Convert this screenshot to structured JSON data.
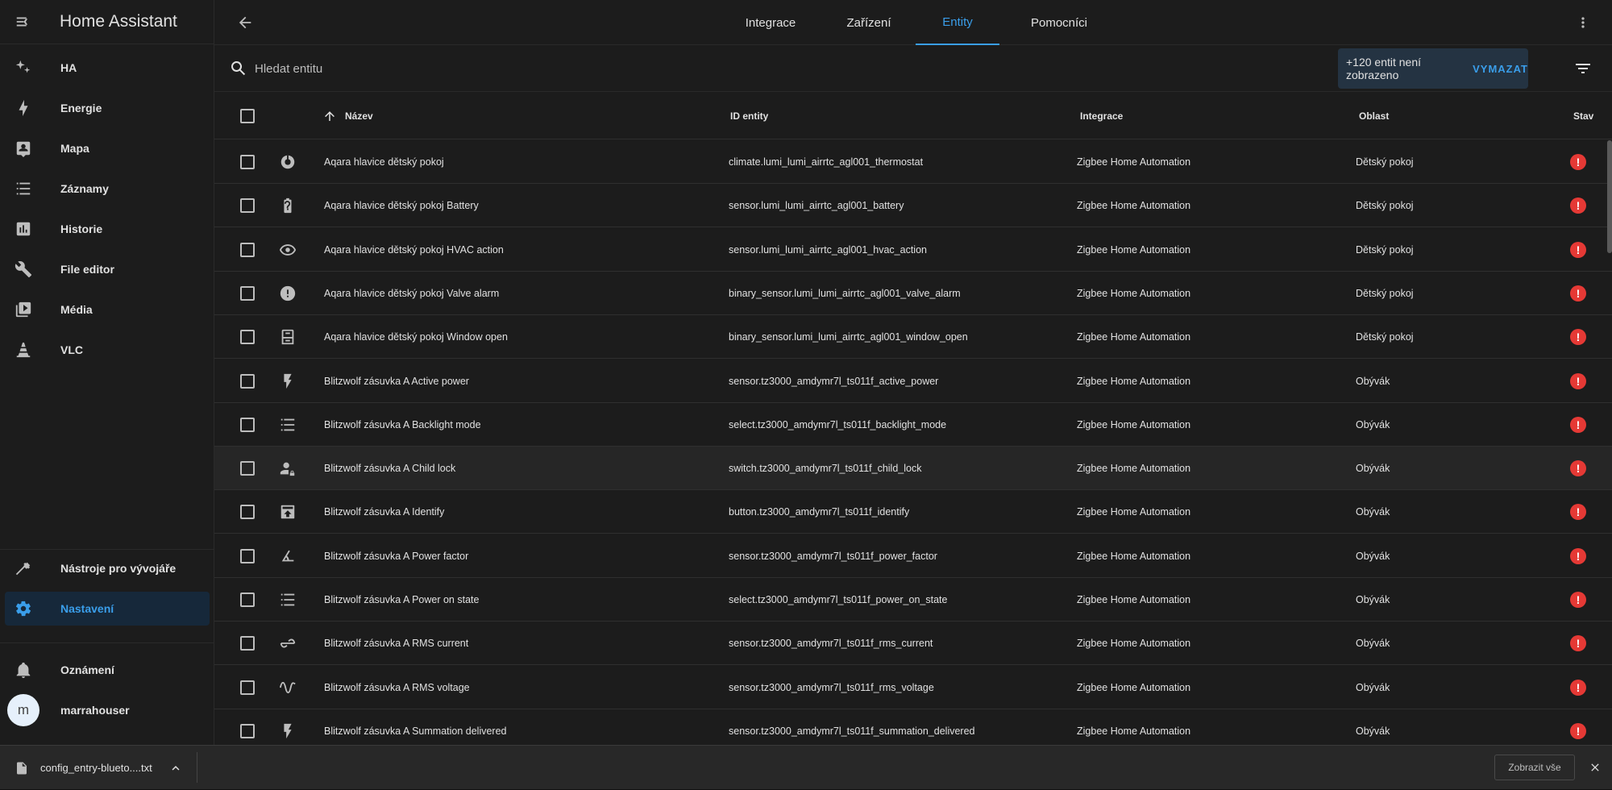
{
  "app": {
    "title": "Home Assistant"
  },
  "sidebar": {
    "items": [
      {
        "label": "HA",
        "icon": "sparkles-icon"
      },
      {
        "label": "Energie",
        "icon": "lightning-icon"
      },
      {
        "label": "Mapa",
        "icon": "map-account-icon"
      },
      {
        "label": "Záznamy",
        "icon": "list-icon"
      },
      {
        "label": "Historie",
        "icon": "chart-box-icon"
      },
      {
        "label": "File editor",
        "icon": "wrench-icon"
      },
      {
        "label": "Média",
        "icon": "play-box-icon"
      },
      {
        "label": "VLC",
        "icon": "vlc-cone-icon"
      }
    ],
    "bottom_items": [
      {
        "label": "Nástroje pro vývojáře",
        "icon": "hammer-icon"
      },
      {
        "label": "Nastavení",
        "icon": "gear-icon"
      }
    ],
    "notifications": "Oznámení",
    "user": {
      "initial": "m",
      "name": "marrahouser"
    }
  },
  "tabs": [
    {
      "label": "Integrace"
    },
    {
      "label": "Zařízení"
    },
    {
      "label": "Entity"
    },
    {
      "label": "Pomocníci"
    }
  ],
  "search": {
    "placeholder": "Hledat entitu",
    "hidden_text": "+120 entit není zobrazeno",
    "clear_label": "VYMAZAT"
  },
  "table": {
    "headers": {
      "name": "Název",
      "entity_id": "ID entity",
      "integration": "Integrace",
      "area": "Oblast",
      "status": "Stav"
    },
    "rows": [
      {
        "icon": "thermostat-icon",
        "name": "Aqara hlavice dětský pokoj",
        "entity_id": "climate.lumi_lumi_airrtc_agl001_thermostat",
        "integration": "Zigbee Home Automation",
        "area": "Dětský pokoj"
      },
      {
        "icon": "battery-unknown-icon",
        "name": "Aqara hlavice dětský pokoj Battery",
        "entity_id": "sensor.lumi_lumi_airrtc_agl001_battery",
        "integration": "Zigbee Home Automation",
        "area": "Dětský pokoj"
      },
      {
        "icon": "eye-icon",
        "name": "Aqara hlavice dětský pokoj HVAC action",
        "entity_id": "sensor.lumi_lumi_airrtc_agl001_hvac_action",
        "integration": "Zigbee Home Automation",
        "area": "Dětský pokoj"
      },
      {
        "icon": "alert-circle-icon",
        "name": "Aqara hlavice dětský pokoj Valve alarm",
        "entity_id": "binary_sensor.lumi_lumi_airrtc_agl001_valve_alarm",
        "integration": "Zigbee Home Automation",
        "area": "Dětský pokoj"
      },
      {
        "icon": "window-icon",
        "name": "Aqara hlavice dětský pokoj Window open",
        "entity_id": "binary_sensor.lumi_lumi_airrtc_agl001_window_open",
        "integration": "Zigbee Home Automation",
        "area": "Dětský pokoj"
      },
      {
        "icon": "flash-icon",
        "name": "Blitzwolf zásuvka A Active power",
        "entity_id": "sensor.tz3000_amdymr7l_ts011f_active_power",
        "integration": "Zigbee Home Automation",
        "area": "Obývák"
      },
      {
        "icon": "format-list-icon",
        "name": "Blitzwolf zásuvka A Backlight mode",
        "entity_id": "select.tz3000_amdymr7l_ts011f_backlight_mode",
        "integration": "Zigbee Home Automation",
        "area": "Obývák"
      },
      {
        "icon": "account-lock-icon",
        "name": "Blitzwolf zásuvka A Child lock",
        "entity_id": "switch.tz3000_amdymr7l_ts011f_child_lock",
        "integration": "Zigbee Home Automation",
        "area": "Obývák"
      },
      {
        "icon": "identify-icon",
        "name": "Blitzwolf zásuvka A Identify",
        "entity_id": "button.tz3000_amdymr7l_ts011f_identify",
        "integration": "Zigbee Home Automation",
        "area": "Obývák"
      },
      {
        "icon": "angle-acute-icon",
        "name": "Blitzwolf zásuvka A Power factor",
        "entity_id": "sensor.tz3000_amdymr7l_ts011f_power_factor",
        "integration": "Zigbee Home Automation",
        "area": "Obývák"
      },
      {
        "icon": "format-list-icon",
        "name": "Blitzwolf zásuvka A Power on state",
        "entity_id": "select.tz3000_amdymr7l_ts011f_power_on_state",
        "integration": "Zigbee Home Automation",
        "area": "Obývák"
      },
      {
        "icon": "current-ac-icon",
        "name": "Blitzwolf zásuvka A RMS current",
        "entity_id": "sensor.tz3000_amdymr7l_ts011f_rms_current",
        "integration": "Zigbee Home Automation",
        "area": "Obývák"
      },
      {
        "icon": "sine-wave-icon",
        "name": "Blitzwolf zásuvka A RMS voltage",
        "entity_id": "sensor.tz3000_amdymr7l_ts011f_rms_voltage",
        "integration": "Zigbee Home Automation",
        "area": "Obývák"
      },
      {
        "icon": "flash-icon",
        "name": "Blitzwolf zásuvka A Summation delivered",
        "entity_id": "sensor.tz3000_amdymr7l_ts011f_summation_delivered",
        "integration": "Zigbee Home Automation",
        "area": "Obývák"
      }
    ]
  },
  "download_bar": {
    "filename": "config_entry-blueto....txt",
    "show_all": "Zobrazit vše"
  },
  "colors": {
    "accent": "#3a9eea",
    "error": "#e53935",
    "background": "#111111",
    "card": "#1c1c1c"
  }
}
